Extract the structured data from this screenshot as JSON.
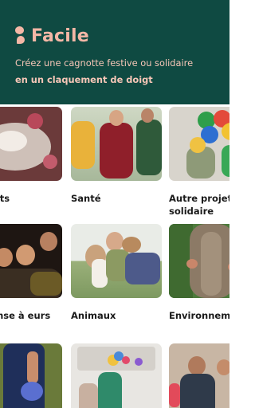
{
  "header": {
    "brand_name": "Facile",
    "tagline": "Créez une cagnotte festive ou solidaire",
    "tagline_strong": "en un claquement de doigt",
    "colors": {
      "background": "#0f4a42",
      "accent": "#f4b7a6"
    }
  },
  "categories": [
    {
      "label": "ements",
      "image": "celebration-confetti-photo"
    },
    {
      "label": "Santé",
      "image": "group-of-men-photo"
    },
    {
      "label": "Autre projet solidaire",
      "image": "child-with-toys-photo"
    },
    {
      "label": "dépense à eurs",
      "image": "evening-gathering-photo"
    },
    {
      "label": "Animaux",
      "image": "boys-with-dog-photo"
    },
    {
      "label": "Environneme",
      "image": "hugging-tree-photo"
    },
    {
      "label": "",
      "image": "flowers-bouquet-photo"
    },
    {
      "label": "",
      "image": "party-decorations-photo"
    },
    {
      "label": "",
      "image": "birthday-party-photo"
    }
  ]
}
